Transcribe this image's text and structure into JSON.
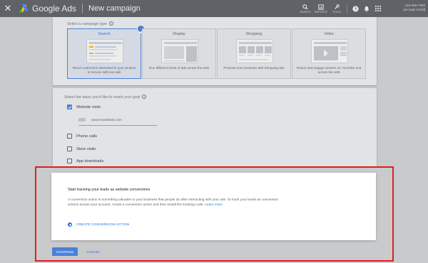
{
  "header": {
    "brand": "Google Ads",
    "page_title": "New campaign",
    "tools": [
      {
        "icon": "search-icon",
        "label": "SEARCH"
      },
      {
        "icon": "reports-icon",
        "label": "REPORTS"
      },
      {
        "icon": "tools-icon",
        "label": "TOOLS"
      }
    ],
    "account_number": "123-456-7890",
    "account_email": "[as login email]"
  },
  "campaign_type": {
    "label": "Select a campaign type",
    "options": [
      {
        "title": "Search",
        "description": "Reach customers interested in your product or service with text ads",
        "selected": true
      },
      {
        "title": "Display",
        "description": "Run different kinds of ads across the web",
        "selected": false
      },
      {
        "title": "Shopping",
        "description": "Promote your products with Shopping ads",
        "selected": false
      },
      {
        "title": "Video",
        "description": "Reach and engage viewers on YouTube and across the web",
        "selected": false
      }
    ]
  },
  "goal": {
    "label": "Select the ways you'd like to reach your goal",
    "website_visits": {
      "label": "Website visits",
      "checked": true
    },
    "website_url": "www.mywebsite.com",
    "phone_calls": {
      "label": "Phone calls",
      "checked": false
    },
    "store_visits": {
      "label": "Store visits",
      "checked": false
    },
    "app_downloads": {
      "label": "App downloads",
      "checked": false
    }
  },
  "conversion": {
    "title": "Start tracking your leads as website conversions",
    "body": "A conversion action is something valuable to your business that people do after interacting with your ads. To track your leads as conversion actions across your account, create a conversion action and then install the tracking code.",
    "learn_more": "Learn more",
    "action": "CREATE CONVERSION ACTION"
  },
  "footer": {
    "continue": "CONTINUE",
    "cancel": "CANCEL"
  },
  "colors": {
    "accent": "#4a80d8",
    "link": "#1a73e8",
    "highlight": "#e01e1e",
    "topbar": "#5f6368"
  }
}
